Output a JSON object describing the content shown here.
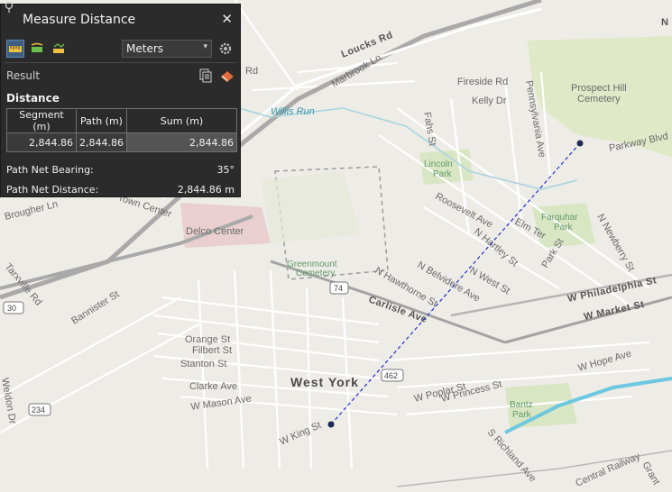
{
  "panel": {
    "title": "Measure Distance",
    "units_value": "Meters",
    "result_label": "Result",
    "distance_heading": "Distance",
    "table": {
      "headers": [
        "Segment (m)",
        "Path (m)",
        "Sum (m)"
      ],
      "row": [
        "2,844.86",
        "2,844.86",
        "2,844.86"
      ]
    },
    "bearing_label": "Path Net Bearing:",
    "bearing_value": "35°",
    "net_distance_label": "Path Net Distance:",
    "net_distance_value": "2,844.86 m"
  },
  "map_labels": {
    "loucks_rd": "Loucks Rd",
    "marbrook_ln": "Marbrook Ln",
    "willis_run": "Willis Run",
    "fireside_rd": "Fireside Rd",
    "kelly_dr": "Kelly Dr",
    "pennsylvania_ave": "Pennsylvania Ave",
    "prospect_hill": "Prospect Hill",
    "cemetery": "Cemetery",
    "parkway_blvd": "Parkway Blvd",
    "fahs_st": "Fahs St",
    "lincoln": "Lincoln",
    "park": "Park",
    "roosevelt_ave": "Roosevelt Ave",
    "elm_ter": "Elm Ter",
    "farquhar": "Farquhar",
    "n_hartley_st": "N Hartley St",
    "n_newberry_st": "N Newberry St",
    "n_belvidere_ave": "N Belvidere Ave",
    "n_west_st": "N West St",
    "park_st": "Park St",
    "w_philadelphia_st": "W Philadelphia St",
    "w_market_st": "W Market St",
    "n_hawthorne_st": "N Hawthorne St",
    "carlisle_ave": "Carlisle Ave",
    "greenmount": "Greenmount",
    "delco_center": "Delco Center",
    "brougher_ln": "Brougher Ln",
    "town_center": "Town Center",
    "tarxville_rd": "Tarxville Rd",
    "bannister_st": "Bannister St",
    "orange_st": "Orange St",
    "filbert_st": "Filbert St",
    "stanton_st": "Stanton St",
    "clarke_ave": "Clarke Ave",
    "w_mason_ave": "W Mason Ave",
    "west_york": "West York",
    "w_king_st": "W King St",
    "w_poplar_st": "W Poplar St",
    "w_princess_st": "W Princess St",
    "bantz": "Bantz",
    "w_hope_ave": "W Hope Ave",
    "s_richland_ave": "S Richland Ave",
    "central_railway": "Central Railway",
    "weldon_dr": "Weldon Dr",
    "rd_label": "Rd",
    "rt_74": "74",
    "rt_462": "462",
    "rt_30": "30",
    "rt_234": "234",
    "n_label": "N",
    "grant": "Grant"
  },
  "colors": {
    "measure_line": "#1f2fd0",
    "panel_bg": "#2b2b2b"
  }
}
